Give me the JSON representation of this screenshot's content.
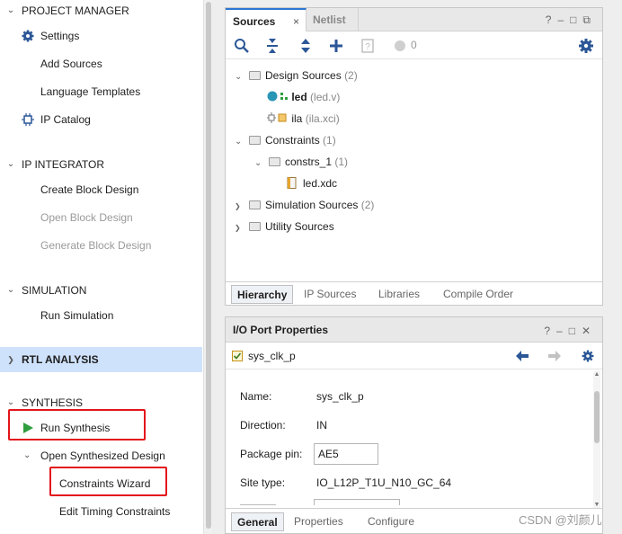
{
  "navigator": {
    "project_manager": {
      "title": "PROJECT MANAGER",
      "items": [
        {
          "label": "Settings",
          "icon": "gear-icon"
        },
        {
          "label": "Add Sources"
        },
        {
          "label": "Language Templates"
        },
        {
          "label": "IP Catalog",
          "icon": "ip-catalog-icon"
        }
      ]
    },
    "ip_integrator": {
      "title": "IP INTEGRATOR",
      "items": [
        {
          "label": "Create Block Design",
          "enabled": true
        },
        {
          "label": "Open Block Design",
          "enabled": false
        },
        {
          "label": "Generate Block Design",
          "enabled": false
        }
      ]
    },
    "simulation": {
      "title": "SIMULATION",
      "items": [
        {
          "label": "Run Simulation"
        }
      ]
    },
    "rtl_analysis": {
      "title": "RTL ANALYSIS",
      "selected": true
    },
    "synthesis": {
      "title": "SYNTHESIS",
      "run_synthesis": "Run Synthesis",
      "open_synth_design": "Open Synthesized Design",
      "constraints_wizard": "Constraints Wizard",
      "edit_timing": "Edit Timing Constraints"
    }
  },
  "sources": {
    "tabs": [
      "Sources",
      "Netlist"
    ],
    "active_tab": "Sources",
    "critical_count": "0",
    "tree": {
      "design_sources": {
        "label": "Design Sources",
        "count": "(2)"
      },
      "led": {
        "label": "led",
        "file": "(led.v)"
      },
      "ila": {
        "label": "ila",
        "file": "(ila.xci)"
      },
      "constraints": {
        "label": "Constraints",
        "count": "(1)"
      },
      "constrs_1": {
        "label": "constrs_1",
        "count": "(1)"
      },
      "led_xdc": {
        "label": "led.xdc"
      },
      "simulation_sources": {
        "label": "Simulation Sources",
        "count": "(2)"
      },
      "utility_sources": {
        "label": "Utility Sources"
      }
    },
    "subtabs": [
      "Hierarchy",
      "IP Sources",
      "Libraries",
      "Compile Order"
    ]
  },
  "io_props": {
    "title": "I/O Port Properties",
    "object": "sys_clk_p",
    "fields": {
      "name": {
        "label": "Name:",
        "value": "sys_clk_p"
      },
      "direction": {
        "label": "Direction:",
        "value": "IN"
      },
      "package_pin": {
        "label": "Package pin:",
        "value": "AE5"
      },
      "site_type": {
        "label": "Site type:",
        "value": "IO_L12P_T1U_N10_GC_64"
      }
    },
    "subtabs": [
      "General",
      "Properties",
      "Configure"
    ]
  },
  "watermark": "CSDN @刘颜儿",
  "colors": {
    "selection": "#cfe2fb",
    "highlight": "#e3141b",
    "accent": "#2f76d2",
    "run_green": "#2f9e3e"
  }
}
